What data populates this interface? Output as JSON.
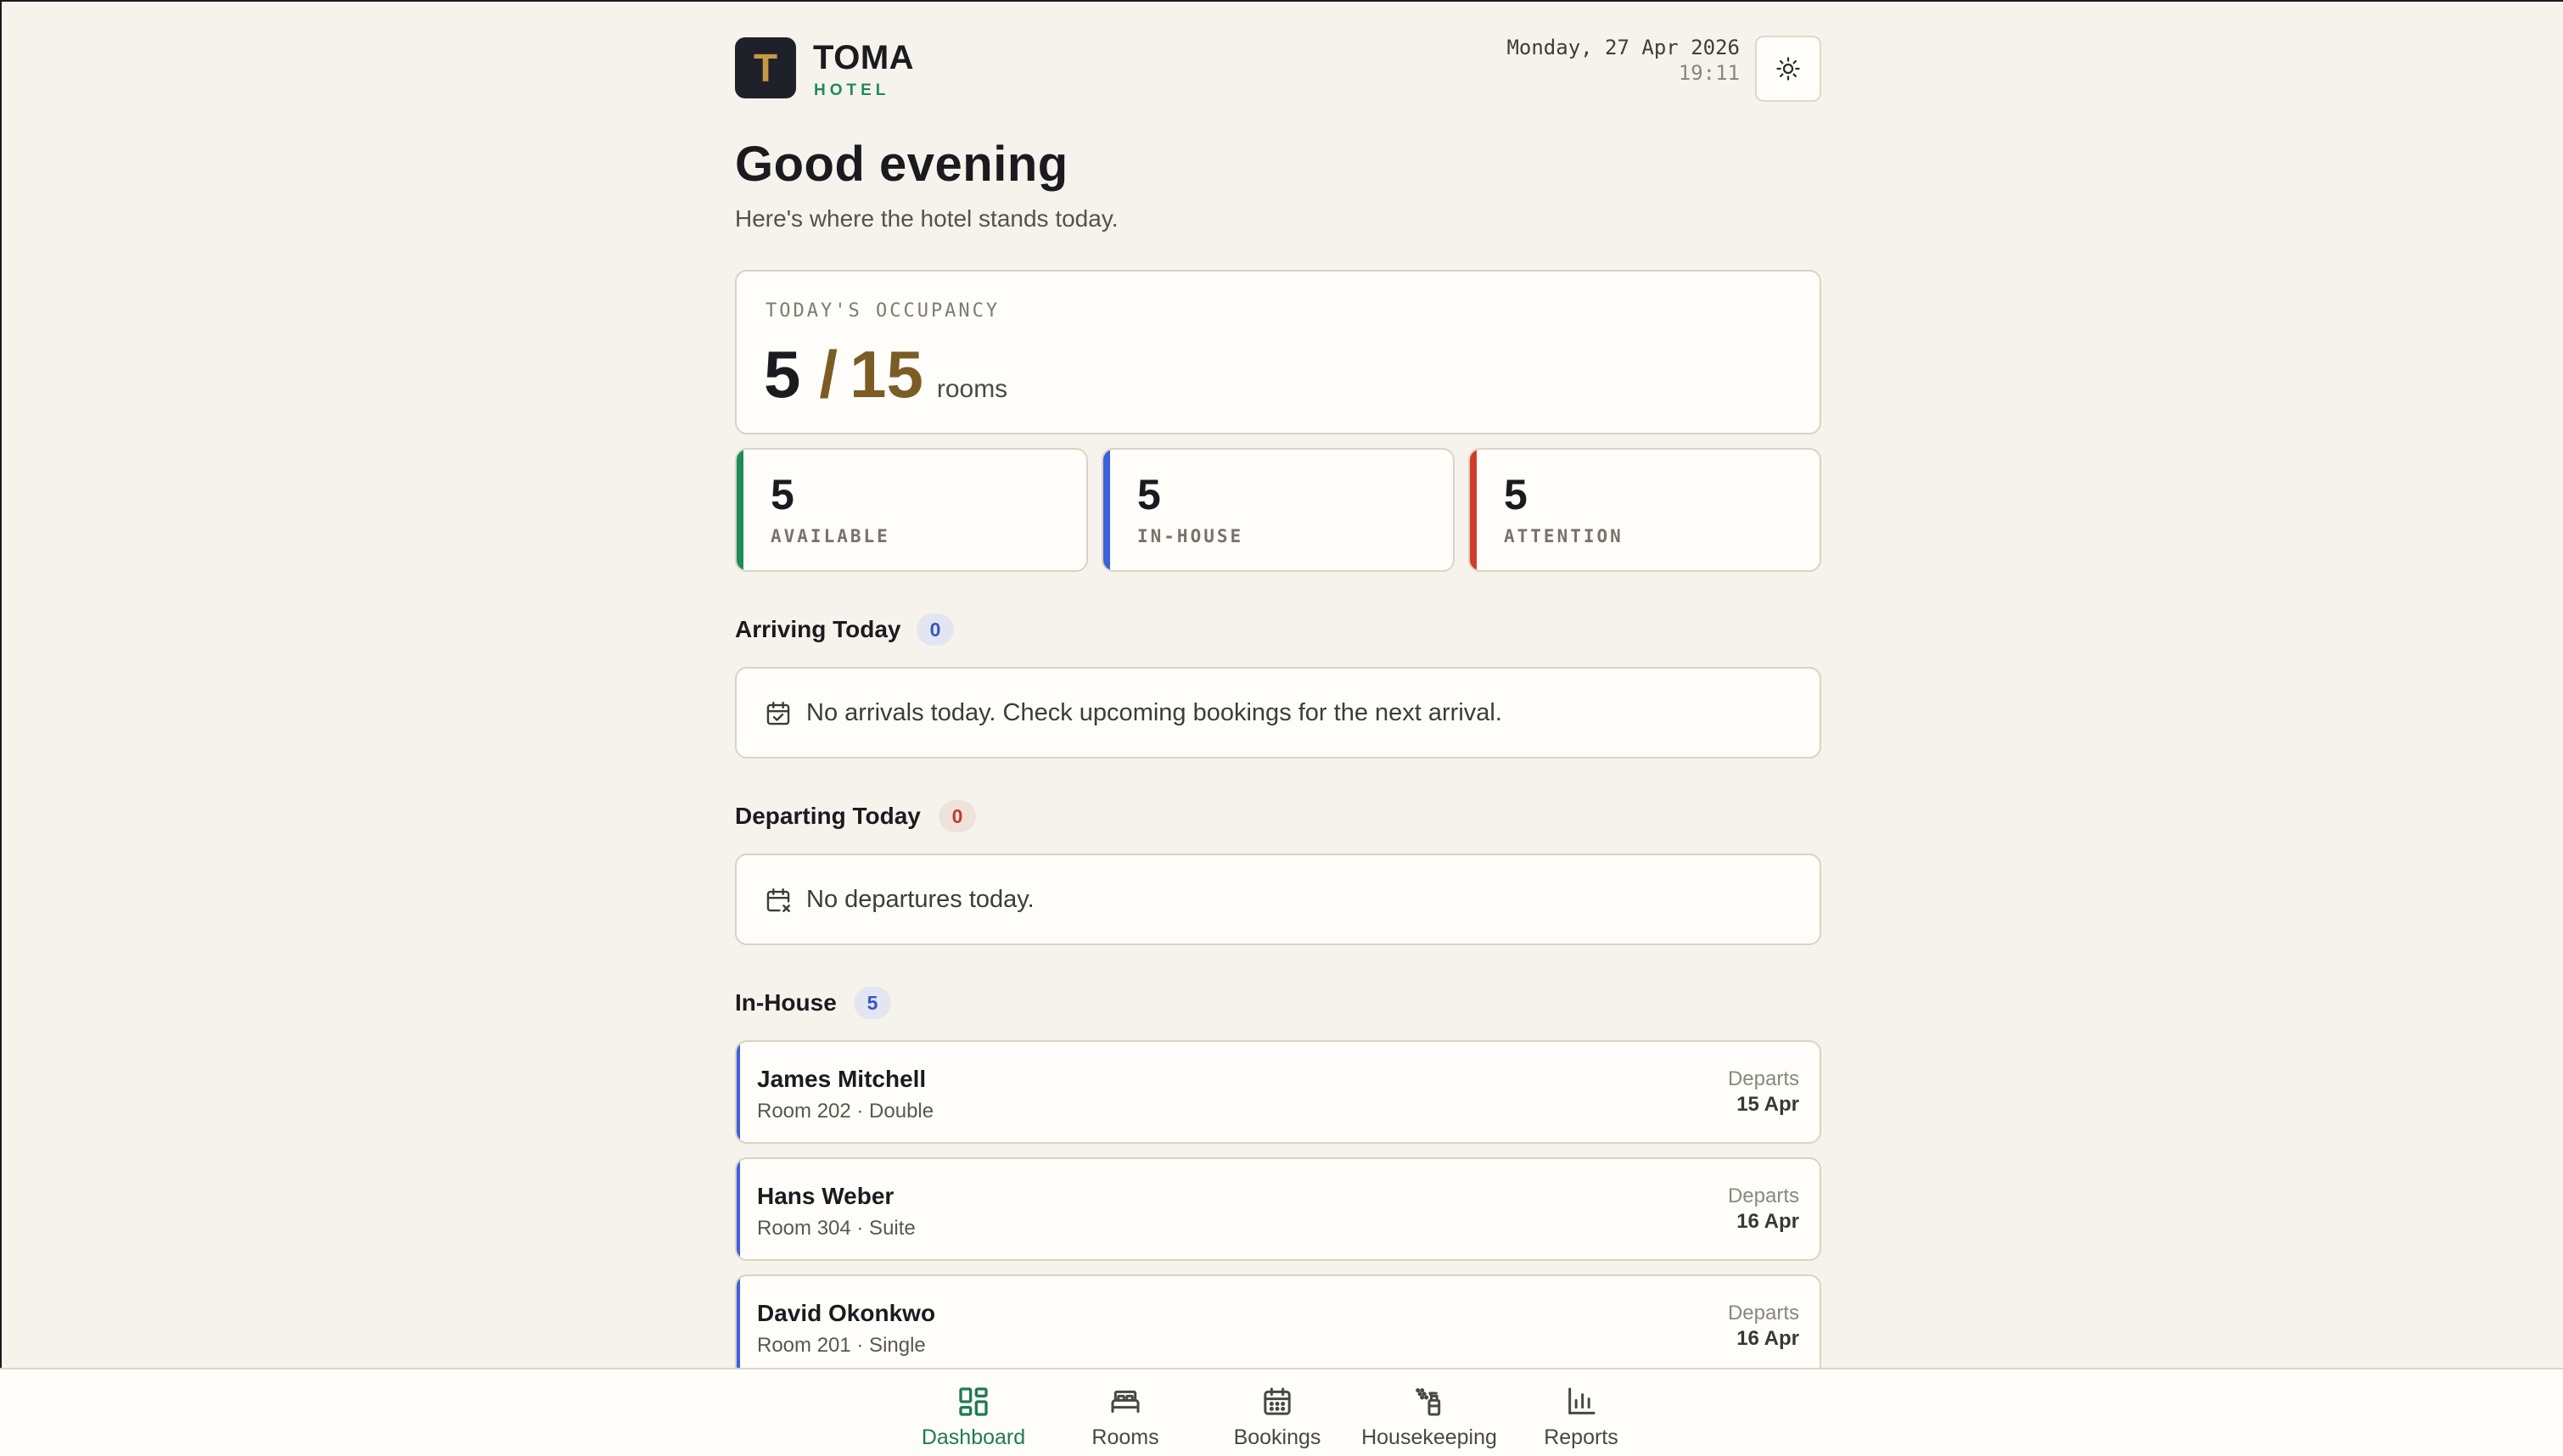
{
  "brand": {
    "logo_letter": "T",
    "name": "TOMA",
    "subtitle": "HOTEL"
  },
  "header": {
    "date": "Monday, 27 Apr 2026",
    "time": "19:11",
    "theme_icon": "sun-icon"
  },
  "greeting": {
    "title": "Good evening",
    "subtitle": "Here's where the hotel stands today."
  },
  "occupancy": {
    "label": "TODAY'S OCCUPANCY",
    "occupied": "5",
    "separator": "/",
    "total": "15",
    "unit": "rooms"
  },
  "stats": [
    {
      "value": "5",
      "label": "AVAILABLE",
      "color": "#1f8a5a"
    },
    {
      "value": "5",
      "label": "IN-HOUSE",
      "color": "#3a62d9"
    },
    {
      "value": "5",
      "label": "ATTENTION",
      "color": "#d13b2c"
    }
  ],
  "arriving": {
    "title": "Arriving Today",
    "count": "0",
    "empty_message": "No arrivals today. Check upcoming bookings for the next arrival.",
    "icon": "calendar-check-icon"
  },
  "departing": {
    "title": "Departing Today",
    "count": "0",
    "empty_message": "No departures today.",
    "icon": "calendar-x-icon"
  },
  "in_house": {
    "title": "In-House",
    "count": "5",
    "guests": [
      {
        "name": "James Mitchell",
        "room": "Room 202 · Double",
        "departs_label": "Departs",
        "departs_date": "15 Apr"
      },
      {
        "name": "Hans Weber",
        "room": "Room 304 · Suite",
        "departs_label": "Departs",
        "departs_date": "16 Apr"
      },
      {
        "name": "David Okonkwo",
        "room": "Room 201 · Single",
        "departs_label": "Departs",
        "departs_date": "16 Apr"
      }
    ]
  },
  "nav": {
    "active": "Dashboard",
    "accent_color": "#1f7a55",
    "items": [
      {
        "label": "Dashboard",
        "icon": "dashboard-icon"
      },
      {
        "label": "Rooms",
        "icon": "bed-icon"
      },
      {
        "label": "Bookings",
        "icon": "calendar-icon"
      },
      {
        "label": "Housekeeping",
        "icon": "spray-bottle-icon"
      },
      {
        "label": "Reports",
        "icon": "bar-chart-icon"
      }
    ]
  }
}
